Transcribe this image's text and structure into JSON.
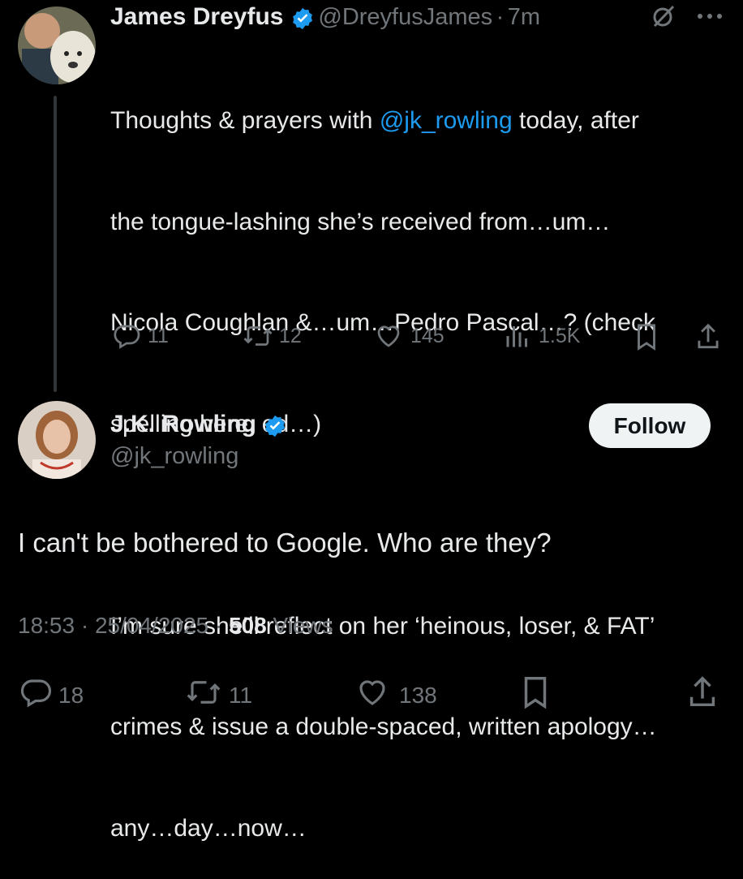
{
  "tweet1": {
    "author_name": "James Dreyfus",
    "author_handle": "@DreyfusJames",
    "time_sep": "·",
    "time": "7m",
    "text_before_mention": "Thoughts & prayers with ",
    "mention": "@jk_rowling",
    "text_line1_rest": " today, after",
    "text_line2": "the tongue-lashing she’s received from…um…",
    "text_line3": "Nicola Coughlan &…um…Pedro Pascal…? (check",
    "text_line4": "spelling here, ed…)",
    "text_line5": "I’m sure she’ll reflect on her ‘heinous, loser, & FAT’",
    "text_line6": "crimes & issue a double-spaced, written apology…",
    "text_line7": "any…day…now…",
    "replies": "11",
    "reposts": "12",
    "likes": "145",
    "views": "1.5K"
  },
  "tweet2": {
    "author_name": "J.K. Rowling",
    "author_handle": "@jk_rowling",
    "follow_label": "Follow",
    "text": "I can't be bothered to Google. Who are they?",
    "time": "18:53",
    "date": "25/04/2025",
    "sep": "·",
    "views_count": "508",
    "views_label": "Views",
    "replies": "18",
    "reposts": "11",
    "likes": "138"
  },
  "colors": {
    "background": "#000000",
    "text": "#e7e9ea",
    "muted": "#71767b",
    "link": "#1d9bf0",
    "verified": "#1d9bf0"
  },
  "icons": [
    "reply-icon",
    "repost-icon",
    "like-icon",
    "views-icon",
    "bookmark-icon",
    "share-icon",
    "grok-icon",
    "more-icon",
    "verified-badge-icon"
  ]
}
